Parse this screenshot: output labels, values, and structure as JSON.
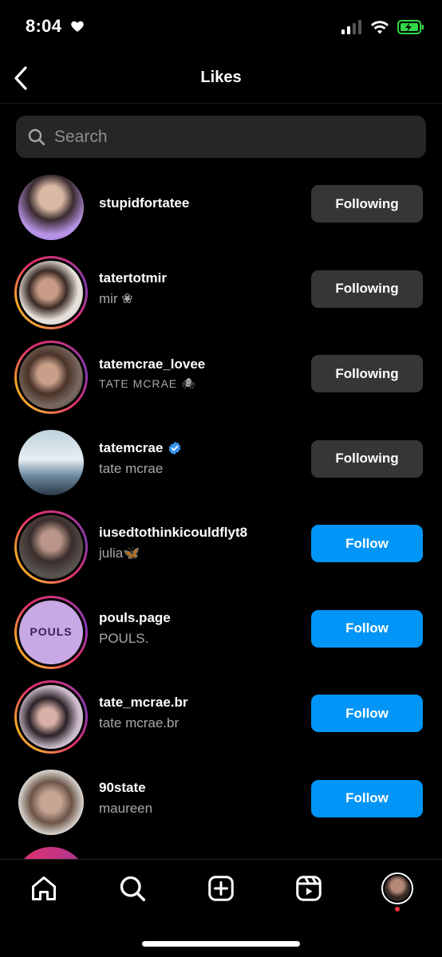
{
  "status": {
    "time": "8:04"
  },
  "nav": {
    "title": "Likes"
  },
  "search": {
    "placeholder": "Search"
  },
  "users": [
    {
      "username": "stupidfortatee",
      "fullname": "",
      "button": "Following",
      "state": "following",
      "story": false
    },
    {
      "username": "tatertotmir",
      "fullname": "mir ❀",
      "button": "Following",
      "state": "following",
      "story": true
    },
    {
      "username": "tatemcrae_lovee",
      "fullname": "TATE MCRAE 🕷",
      "button": "Following",
      "state": "following",
      "story": true
    },
    {
      "username": "tatemcrae",
      "fullname": "tate mcrae",
      "button": "Following",
      "state": "following",
      "story": false,
      "verified": true
    },
    {
      "username": "iusedtothinkicouldflyt8",
      "fullname": "julia🦋",
      "button": "Follow",
      "state": "follow",
      "story": true
    },
    {
      "username": "pouls.page",
      "fullname": "POULS.",
      "button": "Follow",
      "state": "follow",
      "story": true,
      "avatar_text": "POULS"
    },
    {
      "username": "tate_mcrae.br",
      "fullname": "tate mcrae.br",
      "button": "Follow",
      "state": "follow",
      "story": true
    },
    {
      "username": "90state",
      "fullname": "maureen",
      "button": "Follow",
      "state": "follow",
      "story": false
    }
  ],
  "tabs": [
    "home-icon",
    "search-icon",
    "create-icon",
    "reels-icon",
    "profile-avatar"
  ],
  "colors": {
    "follow": "#0095f6",
    "following": "#363636",
    "background": "#000000",
    "verified": "#3897f0"
  }
}
